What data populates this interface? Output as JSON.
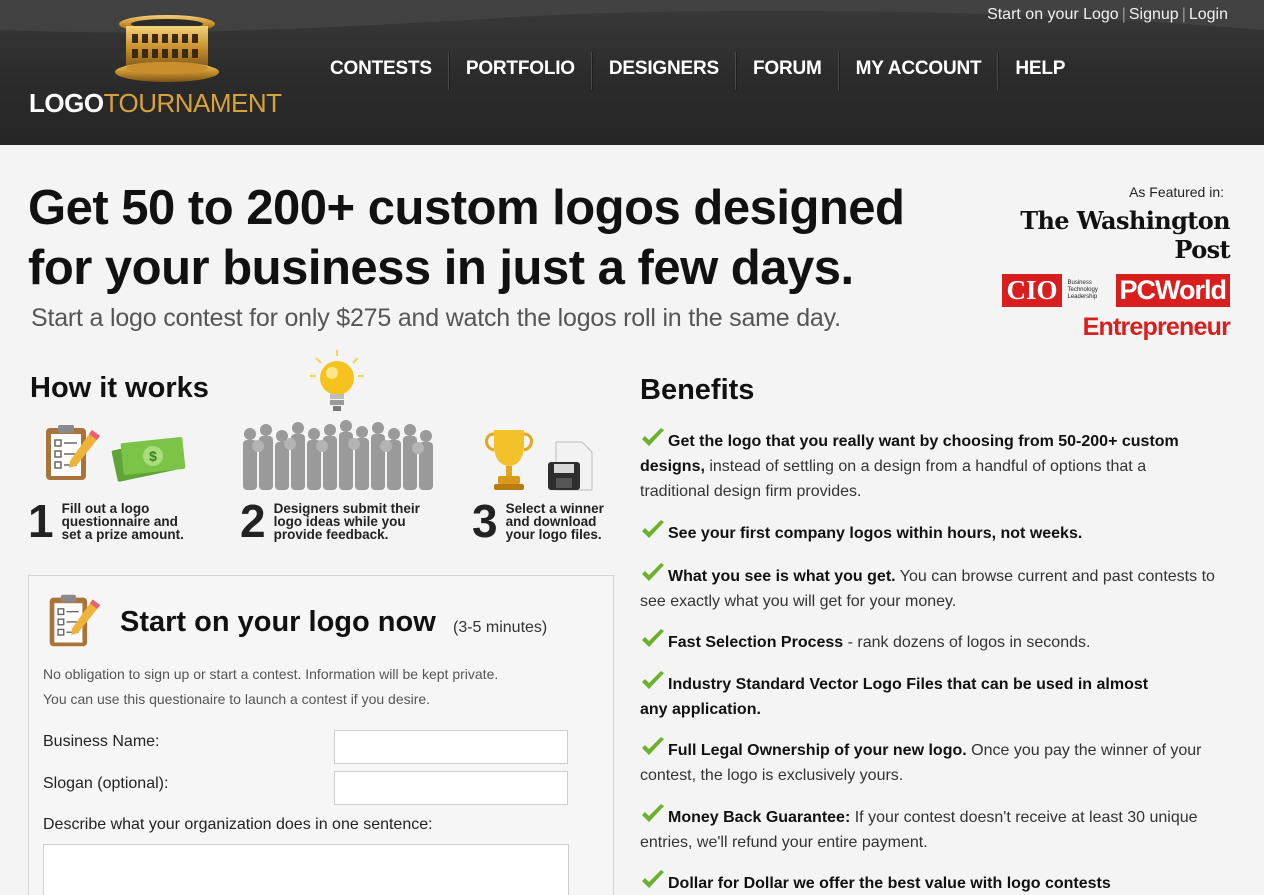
{
  "header": {
    "top_links": [
      "Start on your Logo",
      "Signup",
      "Login"
    ],
    "top_separator": "|",
    "logo": {
      "white": "LOGO",
      "gold": "TOURNAMENT"
    },
    "nav": [
      "CONTESTS",
      "PORTFOLIO",
      "DESIGNERS",
      "FORUM",
      "MY ACCOUNT",
      "HELP"
    ]
  },
  "hero": {
    "title_line1": "Get 50 to 200+ custom logos designed",
    "title_line2": "for your business in just a few days.",
    "subtitle": "Start a logo contest for only $275 and watch the logos roll in the same day."
  },
  "featured": {
    "label": "As Featured in:",
    "washington_post": "The Washington Post",
    "cio": "CIO",
    "cio_tagline": "Business Technology Leadership",
    "pcworld": "PCWorld",
    "entrepreneur": "Entrepreneur"
  },
  "how": {
    "title": "How it works",
    "steps": [
      {
        "num": "1",
        "text": "Fill out a logo questionnaire and set a prize amount."
      },
      {
        "num": "2",
        "text": "Designers submit their logo ideas while you provide feedback."
      },
      {
        "num": "3",
        "text": "Select a winner and download your logo files."
      }
    ]
  },
  "form": {
    "title": "Start on your logo now",
    "time": "(3-5 minutes)",
    "note_line1": "No obligation to sign up or start a contest. Information will be kept private.",
    "note_line2": "You can use this questionaire to launch a contest if you desire.",
    "business_name_label": "Business Name:",
    "slogan_label": "Slogan (optional):",
    "describe_label": "Describe what your organization does in one sentence:",
    "business_name_value": "",
    "slogan_value": ""
  },
  "benefits": {
    "title": "Benefits",
    "items": [
      {
        "bold": "Get the logo that you really want by choosing from 50-200+ custom designs,",
        "rest": " instead of settling on a design from a handful of options that a traditional design firm provides."
      },
      {
        "bold": "See your first company logos within hours, not weeks.",
        "rest": ""
      },
      {
        "bold": "What you see is what you get.",
        "rest": " You can browse current and past contests to see exactly what you will get for your money."
      },
      {
        "bold": "Fast Selection Process",
        "rest": " - rank dozens of logos in seconds."
      },
      {
        "bold": "Industry Standard Vector Logo Files that can be used in almost any application.",
        "rest": ""
      },
      {
        "bold": "Full Legal Ownership of your new logo.",
        "rest": " Once you pay the winner of your contest, the logo is exclusively yours."
      },
      {
        "bold": "Money Back Guarantee:",
        "rest": " If your contest doesn't receive at least 30 unique entries, we'll refund your entire payment."
      },
      {
        "bold": "Dollar for Dollar we offer the best value with logo contests",
        "rest": ""
      }
    ]
  },
  "colors": {
    "header_bg": "#2b2b2b",
    "gold": "#d8a23a",
    "press_red": "#d91e1e",
    "check_green": "#6cb12b"
  }
}
